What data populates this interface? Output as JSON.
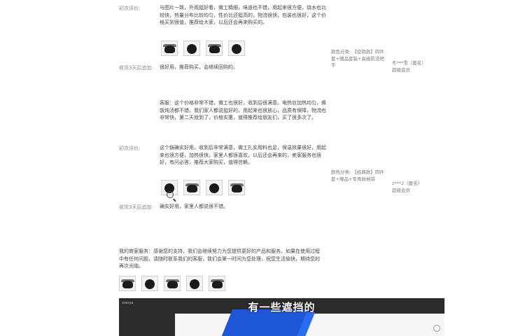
{
  "reviews": [
    {
      "label": "初次评价:",
      "text": "与图片一致，外观挺好看，做工精细，味道也不错，用起来很方便，烧水也比较快，热量分布比较均匀，性价比还挺高的，物流很快，包装也很好，这个价格买到很值，推荐给大家，以后还会再来购买的。",
      "followup_label": "收货3天后追加:",
      "followup_text": "很好用，推荐购买，会继续回购的。",
      "thumbs": 4,
      "category": "颜色分类: 【促销款】四件套+赠品套装+高级防烫把手",
      "user": "冬***雪（匿名）",
      "level": "超级会员"
    },
    {
      "label": "",
      "text": "客服：这个价格非常不错，做工也很好，收到后很满意。电热丝加热均匀，煮饭炖汤都不错，我们家人都说挺好的，用起来也很放心，品质有保障，物流也非常快，第二天就到了，价格实惠，值得推荐给朋友们，买了很多次了。",
      "followup_label": "",
      "followup_text": "",
      "thumbs": 0,
      "category": "",
      "user": "",
      "level": ""
    },
    {
      "label": "初次评价:",
      "text": "这个锅确实好用，收到后非常满意，做工扎实用料也足，保温效果很好，用起来也很方便，加热很快，家里人都很喜欢，以后还会再来的，卖家服务也很好，有问必答，推荐大家购买，值得信赖。",
      "followup_label": "收货3天后追加:",
      "followup_text": "确实好用，家里人都说很不错。",
      "thumbs": 4,
      "category": "颜色分类: 【经典款】四件套+赠品+专用收纳袋",
      "user": "z***2（匿名）",
      "level": "超级会员"
    }
  ],
  "third_review": {
    "text": "我的商家服务：感谢您的支持，我们会继续努力为您提供更好的产品和服务。如果在使用过程中有任何问题，请随时联系我们的客服，我们会第一时间为您处理，祝您生活愉快，期待您的再次光临。",
    "thumbs": 5
  },
  "video": {
    "caption": "有一些遮挡的",
    "tag": "xiaoya"
  }
}
